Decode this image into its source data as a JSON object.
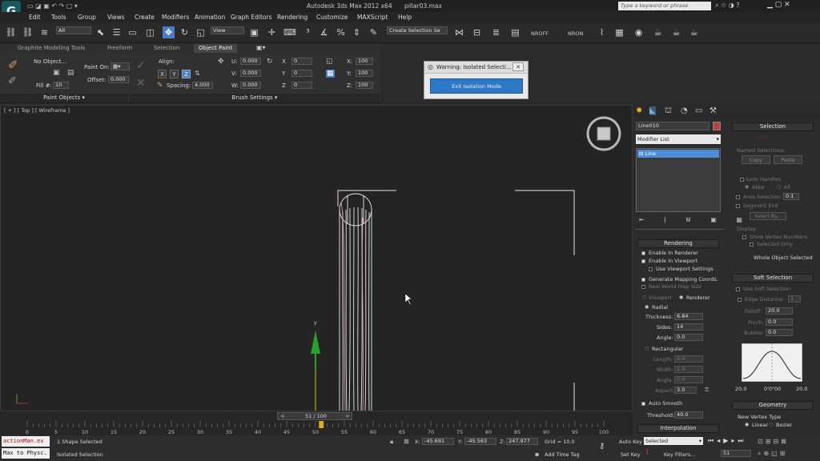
{
  "title_bar": {
    "app_title": "Autodesk 3ds Max  2012 x64",
    "file_name": "pillar03.max",
    "search_placeholder": "Type a keyword or phrase"
  },
  "menu": [
    "Edit",
    "Tools",
    "Group",
    "Views",
    "Create",
    "Modifiers",
    "Animation",
    "Graph Editors",
    "Rendering",
    "Customize",
    "MAXScript",
    "Help"
  ],
  "main_toolbar": {
    "selection_filter": "All",
    "ref_coord": "View",
    "named_selection": "Create Selection Se",
    "nroff": "NROFF",
    "nron": "NRON"
  },
  "ribbon": {
    "tabs": [
      "Graphite Modeling Tools",
      "Freeform",
      "Selection",
      "Object Paint"
    ],
    "active_tab": "Object Paint",
    "no_object": "No Object...",
    "fill_label": "Fill #:",
    "fill_value": "10",
    "paint_on": "Paint On:",
    "offset_label": "Offset:",
    "offset_value": "0.000",
    "align_label": "Align:",
    "xyz": [
      "X",
      "Y",
      "Z"
    ],
    "spacing_label": "Spacing:",
    "spacing_value": "4.000",
    "uvw_labels": [
      "U:",
      "V:",
      "W:"
    ],
    "uvw_values": [
      "0.000",
      "0.000",
      "0.000"
    ],
    "rot_labels": [
      "X",
      "Y",
      "Z"
    ],
    "rot_values": [
      "0",
      "0",
      "0"
    ],
    "scale_labels": [
      "X:",
      "Y:",
      "Z:"
    ],
    "scale_values": [
      "100",
      "100",
      "100"
    ],
    "paint_objects": "Paint Objects",
    "brush_settings": "Brush Settings"
  },
  "warning": {
    "title": "Warning: Isolated Selecti...",
    "button": "Exit Isolation Mode"
  },
  "viewport": {
    "label": "[ + ] [ Top ] [ Wireframe ]",
    "axis_y": "y"
  },
  "command_panel": {
    "object_name": "Line010",
    "modifier_list": "Modifier List",
    "stack_item": "Line",
    "rendering": {
      "title": "Rendering",
      "enable_renderer": "Enable In Renderer",
      "enable_viewport": "Enable In Viewport",
      "use_viewport": "Use Viewport Settings",
      "gen_mapping": "Generate Mapping Coords.",
      "real_world": "Real-World Map Size",
      "viewport_radio": "Viewport",
      "renderer_radio": "Renderer",
      "radial": "Radial",
      "thickness_label": "Thickness:",
      "thickness_value": "6.84",
      "sides_label": "Sides:",
      "sides_value": "14",
      "angle_label": "Angle:",
      "angle_value": "0.0",
      "rectangular": "Rectangular",
      "length_label": "Length:",
      "length_value": "6.0",
      "width_label": "Width:",
      "width_value": "2.0",
      "angle2_label": "Angle:",
      "angle2_value": "0.0",
      "aspect_label": "Aspect:",
      "aspect_value": "3.0",
      "auto_smooth": "Auto Smooth",
      "threshold_label": "Threshold:",
      "threshold_value": "40.0",
      "interpolation": "Interpolation"
    },
    "selection": {
      "title": "Selection",
      "named_selections": "Named Selections:",
      "copy": "Copy",
      "paste": "Paste",
      "lock_handles": "Lock Handles",
      "alike": "Alike",
      "all": "All",
      "area_selection": "Area Selection:",
      "area_value": "0.1",
      "segment_end": "Segment End",
      "select_by": "Select By...",
      "display": "Display",
      "show_vertex_numbers": "Show Vertex Numbers",
      "selected_only": "Selected Only",
      "whole_object_selected": "Whole Object Selected"
    },
    "soft_selection": {
      "title": "Soft Selection",
      "use_soft": "Use Soft Selection",
      "edge_distance": "Edge Distance:",
      "edge_value": "1",
      "falloff_label": "Falloff:",
      "falloff_value": "20.0",
      "pinch_label": "Pinch:",
      "pinch_value": "0.0",
      "bubble_label": "Bubble:",
      "bubble_value": "0.0",
      "curve_left": "20.0",
      "curve_mid": "0'0\"00",
      "curve_right": "20.0"
    },
    "geometry": {
      "title": "Geometry",
      "new_vertex_type": "New Vertex Type",
      "linear": "Linear",
      "bezier": "Bezier"
    }
  },
  "timeline": {
    "frame_display": "51 / 100",
    "ticks": [
      "0",
      "5",
      "10",
      "15",
      "20",
      "25",
      "30",
      "35",
      "40",
      "45",
      "50",
      "55",
      "60",
      "65",
      "70",
      "75",
      "80",
      "85",
      "90",
      "95",
      "100"
    ],
    "current_frame": 51,
    "total_frames": 100
  },
  "status_bar": {
    "script_line1": "actionMan.ex",
    "script_line2": "Max to Physc.",
    "shapes_selected": "1 Shape Selected",
    "isolated_selection": "Isolated Selection",
    "x_label": "X:",
    "x_value": "-45.691",
    "y_label": "Y:",
    "y_value": "-45.563",
    "z_label": "Z:",
    "z_value": "247.977",
    "grid": "Grid = 10.0",
    "add_time_tag": "Add Time Tag",
    "auto_key": "Auto Key",
    "set_key": "Set Key",
    "selected_dropdown": "Selected",
    "key_filters": "Key Filters...",
    "frame_field": "51"
  }
}
